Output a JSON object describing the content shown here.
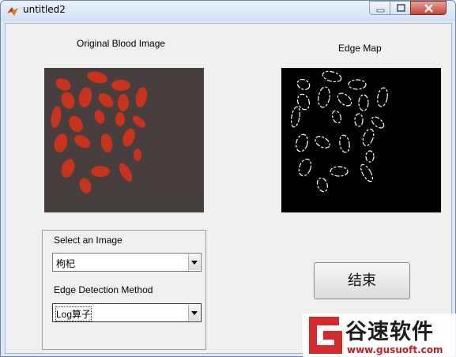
{
  "window": {
    "title": "untitled2"
  },
  "left_image": {
    "caption": "Original Blood Image"
  },
  "right_image": {
    "caption": "Edge Map"
  },
  "panel": {
    "image_label": "Select an Image",
    "image_value": "枸杞",
    "method_label": "Edge Detection Method",
    "method_value": "Log算子"
  },
  "end_button": {
    "label": "结束"
  },
  "watermark": {
    "name": "谷速软件",
    "url": "www.gusuoft.com"
  },
  "colors": {
    "cells": "#c8331c",
    "cell_background": "#463f3e",
    "edge_background": "#000000",
    "edge_lines": "#ffffff",
    "brand_red": "#d42a2a"
  },
  "icons": [
    "matlab-icon",
    "minimize-icon",
    "maximize-icon",
    "close-icon",
    "dropdown-arrow-icon",
    "gusu-logo-icon"
  ]
}
